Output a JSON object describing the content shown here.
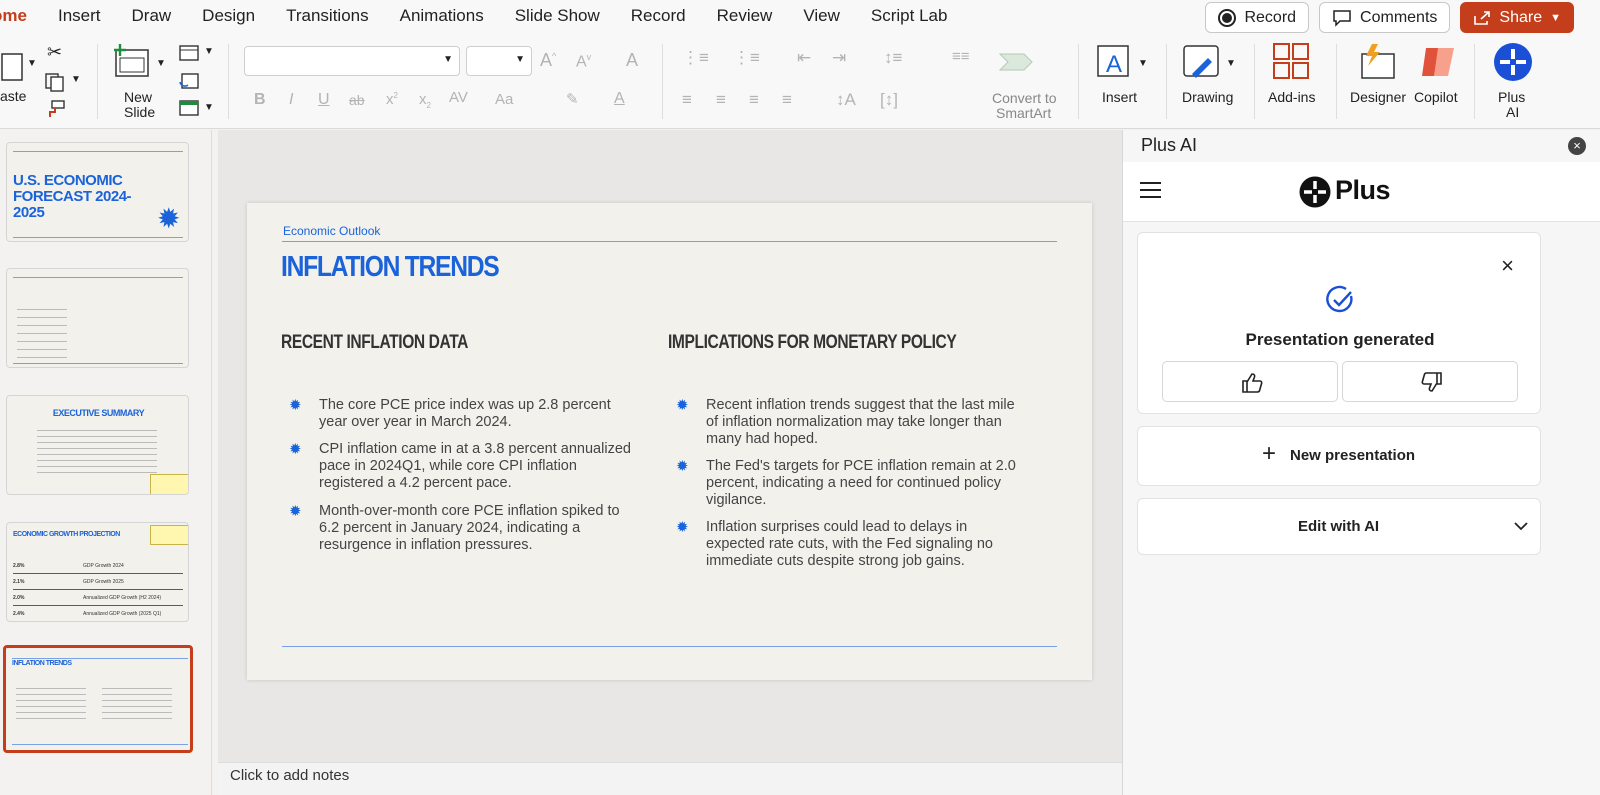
{
  "menu": {
    "items": [
      "ome",
      "Insert",
      "Draw",
      "Design",
      "Transitions",
      "Animations",
      "Slide Show",
      "Record",
      "Review",
      "View",
      "Script Lab"
    ],
    "record_label": "Record",
    "comments_label": "Comments",
    "share_label": "Share"
  },
  "ribbon": {
    "paste_label": "aste",
    "new_slide_label_1": "New",
    "new_slide_label_2": "Slide",
    "smartart_label_1": "Convert to",
    "smartart_label_2": "SmartArt",
    "insert_label": "Insert",
    "drawing_label": "Drawing",
    "addins_label": "Add-ins",
    "designer_label": "Designer",
    "copilot_label": "Copilot",
    "plusai_label_1": "Plus",
    "plusai_label_2": "AI"
  },
  "thumbnails": {
    "t1_title": "U.S. ECONOMIC FORECAST 2024-2025",
    "t3_title": "EXECUTIVE SUMMARY",
    "t4_title": "ECONOMIC GROWTH PROJECTION",
    "t4_rows": [
      [
        "2.8%",
        "GDP Growth 2024"
      ],
      [
        "2.1%",
        "GDP Growth 2025"
      ],
      [
        "2.0%",
        "Annualized GDP Growth (H2 2024)"
      ],
      [
        "2.4%",
        "Annualized GDP Growth (2025 Q1)"
      ]
    ],
    "t5_title": "INFLATION TRENDS"
  },
  "slide": {
    "kicker": "Economic Outlook",
    "title": "INFLATION TRENDS",
    "left_heading": "RECENT INFLATION DATA",
    "right_heading": "IMPLICATIONS FOR MONETARY POLICY",
    "left_bullets": [
      "The core PCE price index was up 2.8 percent year over year in March 2024.",
      "CPI inflation came in at a 3.8 percent annualized pace in 2024Q1, while core CPI inflation registered a 4.2 percent pace.",
      "Month-over-month core PCE inflation spiked to 6.2 percent in January 2024, indicating a resurgence in inflation pressures."
    ],
    "right_bullets": [
      "Recent inflation trends suggest that the last mile of inflation normalization may take longer than many had hoped.",
      "The Fed's targets for PCE inflation remain at 2.0 percent, indicating a need for continued policy vigilance.",
      "Inflation surprises could lead to delays in expected rate cuts, with the Fed signaling no immediate cuts despite strong job gains."
    ]
  },
  "notes_placeholder": "Click to add notes",
  "panel": {
    "title": "Plus AI",
    "brand": "Plus",
    "status": "Presentation generated",
    "new_presentation": "New presentation",
    "edit_with_ai": "Edit with AI"
  },
  "colors": {
    "accent": "#c43e1c",
    "slide_blue": "#1a63d9"
  }
}
